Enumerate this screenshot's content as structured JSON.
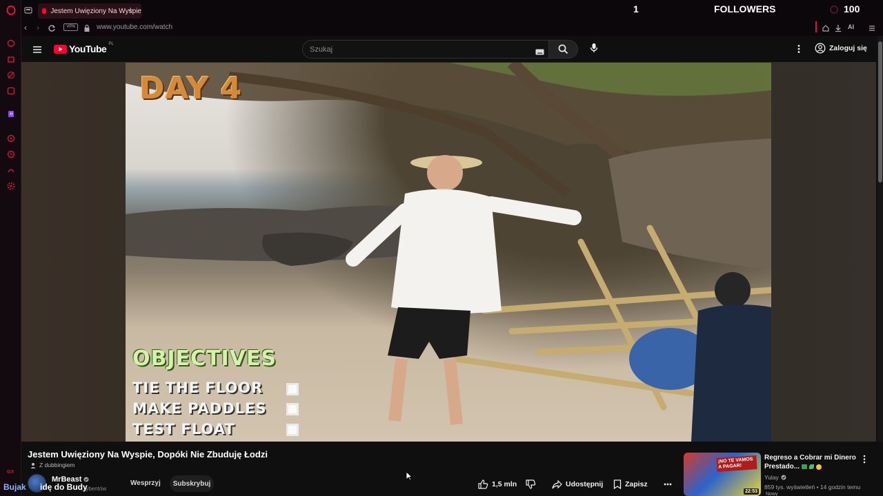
{
  "browser": {
    "tab_title": "Jestem Uwięziony Na Wyspie",
    "url": "www.youtube.com/watch",
    "vpn_label": "VPN",
    "ai_label": "AI"
  },
  "overlay": {
    "count": "1",
    "followers_label": "FOLLOWERS",
    "goal": "100",
    "streamer_name": "Bujak",
    "watermark_text": "idę do Budy",
    "corner_mark": "GX"
  },
  "youtube": {
    "logo_text": "YouTube",
    "region": "PL",
    "search_placeholder": "Szukaj",
    "sign_in": "Zaloguj się"
  },
  "video": {
    "day_label": "DAY 4",
    "objectives_title": "OBJECTIVES",
    "objectives": [
      "TIE THE FLOOR",
      "MAKE PADDLES",
      "TEST FLOAT"
    ]
  },
  "meta": {
    "title": "Jestem Uwięziony Na Wyspie, Dopóki Nie Zbuduję Łodzi",
    "dubbing": "Z dubbingiem",
    "channel": "MrBeast",
    "subscribers_partial": "...rybentów",
    "support": "Wesprzyj",
    "subscribe": "Subskrybuj",
    "likes": "1,5 mln",
    "share": "Udostępnij",
    "save": "Zapisz"
  },
  "recommendation": {
    "title_line1": "Regreso a Cobrar mi Dinero",
    "title_line2": "Prestado...",
    "channel": "Yulay",
    "stats": "859 tys. wyświetleń • 14 godzin temu",
    "duration": "22:53",
    "thumb_text": "¡NO TE VAMOS A PAGAR!",
    "more_partial": "Nowy"
  },
  "colors": {
    "accent_red": "#ff0033",
    "opera_red": "#e0163e",
    "background": "#0f0f10"
  }
}
